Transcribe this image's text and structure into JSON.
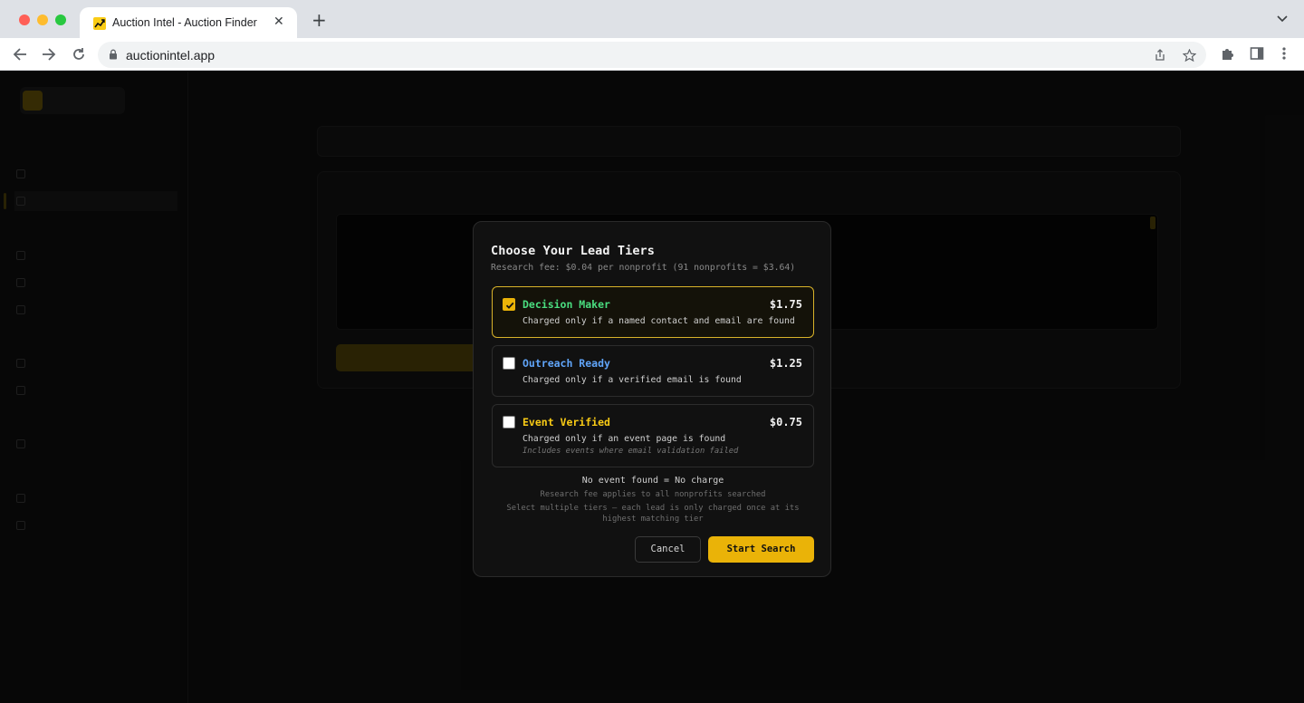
{
  "browser": {
    "tab_title": "Auction Intel - Auction Finder",
    "tab_close_glyph": "✕",
    "new_tab_glyph": "+",
    "url": "auctionintel.app"
  },
  "modal": {
    "title": "Choose Your Lead Tiers",
    "subtitle": "Research fee: $0.04 per nonprofit (91 nonprofits = $3.64)",
    "tiers": [
      {
        "name": "Decision Maker",
        "price": "$1.75",
        "description": "Charged only if a named contact and email are found",
        "checked": true,
        "color": "#4ade80"
      },
      {
        "name": "Outreach Ready",
        "price": "$1.25",
        "description": "Charged only if a verified email is found",
        "checked": false,
        "color": "#60a5fa"
      },
      {
        "name": "Event Verified",
        "price": "$0.75",
        "description": "Charged only if an event page is found",
        "note": "Includes events where email validation failed",
        "checked": false,
        "color": "#facc15"
      }
    ],
    "footer_main": "No event found = No charge",
    "footer_fee_note": "Research fee applies to all nonprofits searched",
    "footer_multi_note": "Select multiple tiers — each lead is only charged once at its highest matching tier",
    "cancel_label": "Cancel",
    "start_label": "Start Search"
  },
  "colors": {
    "accent": "#eab308",
    "selected_border": "#d8b22a",
    "modal_bg": "#111111"
  }
}
